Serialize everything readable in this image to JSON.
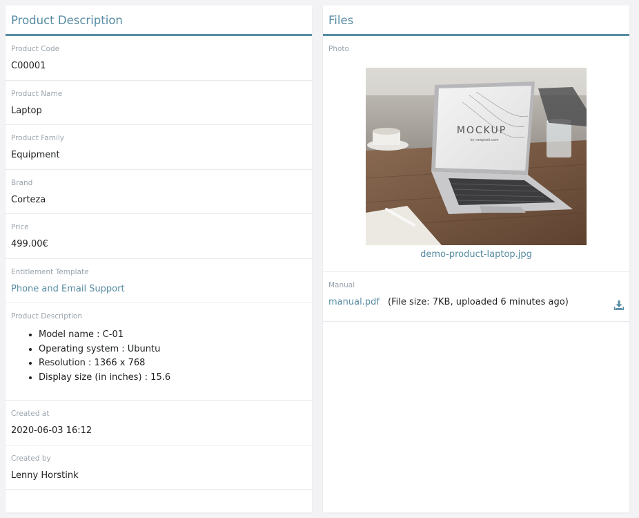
{
  "left_card": {
    "title": "Product Description",
    "fields": {
      "product_code": {
        "label": "Product Code",
        "value": "C00001"
      },
      "product_name": {
        "label": "Product Name",
        "value": "Laptop"
      },
      "product_family": {
        "label": "Product Family",
        "value": "Equipment"
      },
      "brand": {
        "label": "Brand",
        "value": "Corteza"
      },
      "price": {
        "label": "Price",
        "value": "499.00€"
      },
      "entitlement_template": {
        "label": "Entitlement Template",
        "value": "Phone and Email Support"
      },
      "product_description": {
        "label": "Product Description",
        "items": [
          "Model name : C-01",
          "Operating system : Ubuntu",
          "Resolution : 1366 x 768",
          "Display size (in inches) : 15.6"
        ]
      },
      "created_at": {
        "label": "Created at",
        "value": "2020-06-03 16:12"
      },
      "created_by": {
        "label": "Created by",
        "value": "Lenny Horstink"
      }
    }
  },
  "right_card": {
    "title": "Files",
    "photo": {
      "label": "Photo",
      "image_text": "MOCKUP",
      "image_subtext": "by rawpixel.com",
      "file_name": "demo-product-laptop.jpg"
    },
    "manual": {
      "label": "Manual",
      "file_name": "manual.pdf",
      "file_info": "(File size: 7KB, uploaded 6 minutes ago)",
      "download_icon": "download-icon"
    }
  },
  "colors": {
    "accent": "#568ba2",
    "label": "#9aa4ad",
    "text": "#1e2022",
    "background": "#f3f3f5"
  }
}
